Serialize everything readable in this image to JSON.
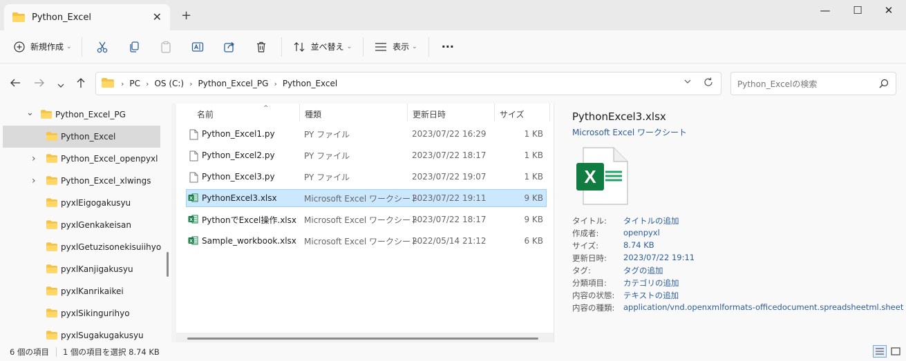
{
  "window": {
    "tab_title": "Python_Excel",
    "tab_close": "✕",
    "new_tab": "+",
    "minimize": "—",
    "maximize": "☐",
    "close": "✕"
  },
  "toolbar": {
    "new_label": "新規作成",
    "sort_label": "並べ替え",
    "view_label": "表示",
    "more_label": "···"
  },
  "address": {
    "crumbs": [
      "PC",
      "OS (C:)",
      "Python_Excel_PG",
      "Python_Excel"
    ],
    "search_placeholder": "Python_Excelの検索"
  },
  "nav": {
    "items": [
      {
        "label": "Python_Excel_PG",
        "expander": "expanded"
      },
      {
        "label": "Python_Excel",
        "expander": "none",
        "selected": true
      },
      {
        "label": "Python_Excel_openpyxl",
        "expander": "collapsed"
      },
      {
        "label": "Python_Excel_xlwings",
        "expander": "collapsed"
      },
      {
        "label": "pyxlEigogakusyu",
        "expander": "none"
      },
      {
        "label": "pyxlGenkakeisan",
        "expander": "none"
      },
      {
        "label": "pyxlGetuzisonekisuiihyo",
        "expander": "none"
      },
      {
        "label": "pyxlKanjigakusyu",
        "expander": "none"
      },
      {
        "label": "pyxlKanrikaikei",
        "expander": "none"
      },
      {
        "label": "pyxlSikingurihyo",
        "expander": "none"
      },
      {
        "label": "pyxlSugakugakusyu",
        "expander": "none"
      }
    ]
  },
  "files": {
    "columns": {
      "name": "名前",
      "type": "種類",
      "date": "更新日時",
      "size": "サイズ"
    },
    "rows": [
      {
        "name": "Python_Excel1.py",
        "type": "PY ファイル",
        "date": "2023/07/22 16:29",
        "size": "1 KB",
        "icon": "file-icon"
      },
      {
        "name": "Python_Excel2.py",
        "type": "PY ファイル",
        "date": "2023/07/22 18:17",
        "size": "1 KB",
        "icon": "file-icon"
      },
      {
        "name": "Python_Excel3.py",
        "type": "PY ファイル",
        "date": "2023/07/22 19:07",
        "size": "1 KB",
        "icon": "file-icon"
      },
      {
        "name": "PythonExcel3.xlsx",
        "type": "Microsoft Excel ワークシート",
        "date": "2023/07/22 19:11",
        "size": "9 KB",
        "icon": "excel-icon",
        "selected": true
      },
      {
        "name": "PythonでExcel操作.xlsx",
        "type": "Microsoft Excel ワークシート",
        "date": "2023/07/22 18:17",
        "size": "9 KB",
        "icon": "excel-icon"
      },
      {
        "name": "Sample_workbook.xlsx",
        "type": "Microsoft Excel ワークシート",
        "date": "2022/05/14 21:12",
        "size": "6 KB",
        "icon": "excel-icon"
      }
    ]
  },
  "details": {
    "title": "PythonExcel3.xlsx",
    "subtitle": "Microsoft Excel ワークシート",
    "properties": [
      {
        "key": "タイトル:",
        "value": "タイトルの追加"
      },
      {
        "key": "作成者:",
        "value": "openpyxl"
      },
      {
        "key": "サイズ:",
        "value": "8.74 KB"
      },
      {
        "key": "更新日時:",
        "value": "2023/07/22 19:11"
      },
      {
        "key": "タグ:",
        "value": "タグの追加"
      },
      {
        "key": "分類項目:",
        "value": "カテゴリの追加"
      },
      {
        "key": "内容の状態:",
        "value": "テキストの追加"
      },
      {
        "key": "内容の種類:",
        "value": "application/vnd.openxmlformats-officedocument.spreadsheetml.sheet"
      }
    ]
  },
  "status": {
    "count": "6 個の項目",
    "selection": "1 個の項目を選択 8.74 KB"
  },
  "colors": {
    "accent": "#0078d4",
    "folder": "#f5c242",
    "excel_green": "#107c41",
    "selection": "#cce8ff"
  }
}
